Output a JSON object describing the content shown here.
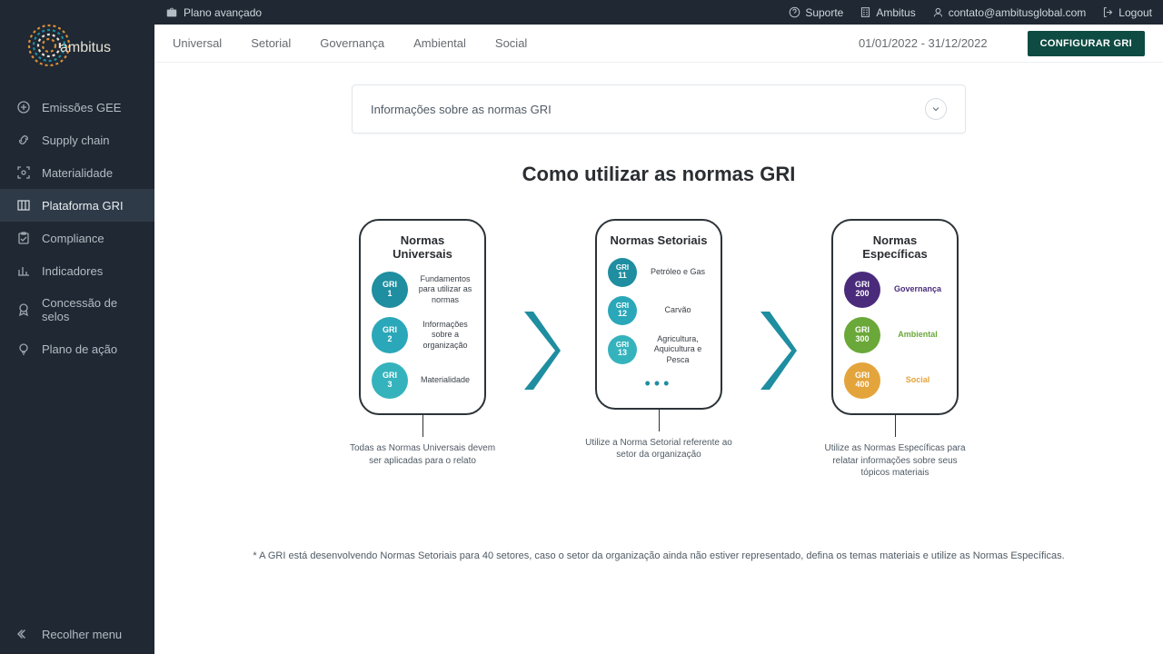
{
  "plan_label": "Plano avançado",
  "top_links": {
    "support": "Suporte",
    "org": "Ambitus",
    "email": "contato@ambitusglobal.com",
    "logout": "Logout"
  },
  "tabs": [
    "Universal",
    "Setorial",
    "Governança",
    "Ambiental",
    "Social"
  ],
  "date_range": "01/01/2022 - 31/12/2022",
  "config_button": "CONFIGURAR GRI",
  "accordion_title": "Informações sobre as normas GRI",
  "section_title": "Como utilizar as normas GRI",
  "sidebar": {
    "items": [
      {
        "label": "Emissões GEE"
      },
      {
        "label": "Supply chain"
      },
      {
        "label": "Materialidade"
      },
      {
        "label": "Plataforma GRI"
      },
      {
        "label": "Compliance"
      },
      {
        "label": "Indicadores"
      },
      {
        "label": "Concessão de selos"
      },
      {
        "label": "Plano de ação"
      }
    ],
    "collapse": "Recolher menu"
  },
  "cards": {
    "universal": {
      "title": "Normas Universais",
      "items": [
        {
          "code": "GRI",
          "num": "1",
          "label": "Fundamentos para utilizar as normas"
        },
        {
          "code": "GRI",
          "num": "2",
          "label": "Informações sobre a organização"
        },
        {
          "code": "GRI",
          "num": "3",
          "label": "Materialidade"
        }
      ],
      "caption": "Todas as Normas Universais devem ser aplicadas para o relato"
    },
    "sectorial": {
      "title": "Normas Setoriais",
      "items": [
        {
          "code": "GRI",
          "num": "11",
          "label": "Petróleo e Gas"
        },
        {
          "code": "GRI",
          "num": "12",
          "label": "Carvão"
        },
        {
          "code": "GRI",
          "num": "13",
          "label": "Agricultura, Aquicultura e Pesca"
        }
      ],
      "caption": "Utilize a Norma Setorial referente ao setor da organização"
    },
    "specific": {
      "title": "Normas Específicas",
      "items": [
        {
          "code": "GRI",
          "num": "200",
          "label": "Governança"
        },
        {
          "code": "GRI",
          "num": "300",
          "label": "Ambiental"
        },
        {
          "code": "GRI",
          "num": "400",
          "label": "Social"
        }
      ],
      "caption": "Utilize as Normas Específicas para relatar informações sobre seus tópicos materiais"
    }
  },
  "footnote": "* A GRI está desenvolvendo Normas Setoriais para 40 setores, caso o setor da organização ainda não estiver representado, defina os temas materiais e utilize as Normas Específicas."
}
